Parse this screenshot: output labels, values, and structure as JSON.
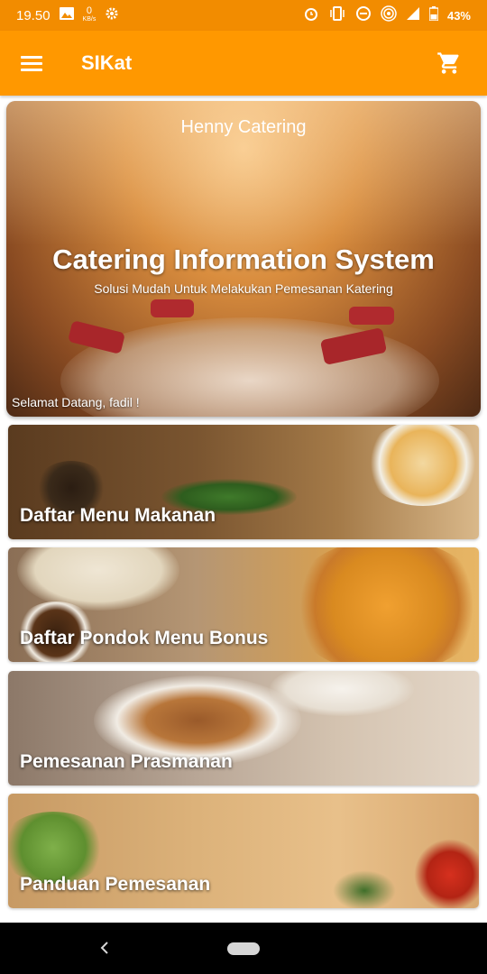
{
  "status_bar": {
    "time": "19.50",
    "net_speed_value": "0",
    "net_speed_unit": "KB/s",
    "battery": "43%"
  },
  "app_bar": {
    "title": "SIKat"
  },
  "hero": {
    "subtitle": "Henny Catering",
    "title": "Catering Information System",
    "tagline": "Solusi Mudah Untuk Melakukan Pemesanan Katering",
    "welcome": "Selamat Datang, fadil !"
  },
  "menu": [
    {
      "label": "Daftar Menu Makanan"
    },
    {
      "label": "Daftar Pondok Menu Bonus"
    },
    {
      "label": "Pemesanan Prasmanan"
    },
    {
      "label": "Panduan Pemesanan"
    }
  ],
  "colors": {
    "status_bar": "#F28C00",
    "app_bar": "#FF9800"
  }
}
